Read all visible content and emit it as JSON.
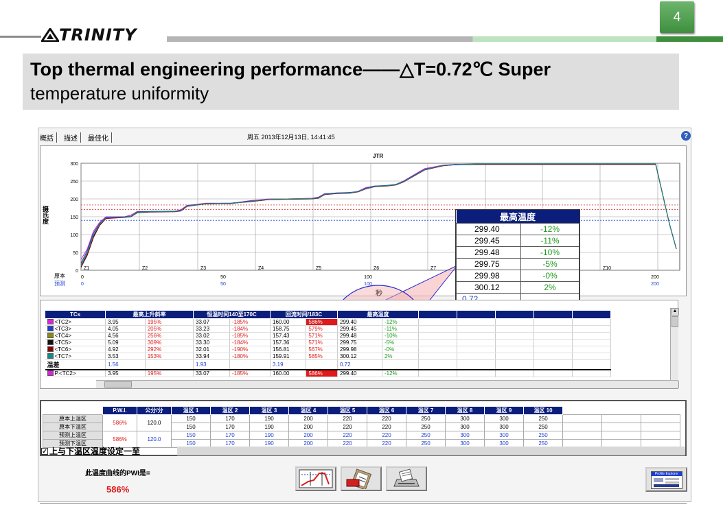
{
  "slide": {
    "page_number": "4",
    "logo": "TRINITY",
    "title_line1": "Top thermal engineering performance——△T=0.72℃ Super",
    "title_line2": "temperature uniformity"
  },
  "app": {
    "tabs": [
      "概括",
      "描述",
      "最佳化"
    ],
    "datetime": "周五 2013年12月13日, 14:41:45",
    "help_icon": "?"
  },
  "chart_data": {
    "type": "line",
    "title": "JTR",
    "ylabel": "摄氏度",
    "xlabel": "秒",
    "ylim": [
      0,
      300
    ],
    "xlim": [
      0,
      200
    ],
    "y_ticks": [
      "300",
      "250",
      "200",
      "150",
      "100",
      "50",
      "0"
    ],
    "x_ticks_top": [
      "0",
      "50",
      "100",
      "150",
      "200"
    ],
    "x_ticks_bottom": [
      "0",
      "50",
      "100",
      "150",
      "200"
    ],
    "row_labels": [
      "原本",
      "预测"
    ],
    "zone_labels": [
      "Z1",
      "Z2",
      "Z3",
      "Z4",
      "Z5",
      "Z6",
      "Z7",
      "Z8",
      "Z9",
      "Z10"
    ],
    "reference_lines": [
      183,
      170,
      140
    ],
    "series": [
      {
        "color": "#e020e0",
        "x": [
          0,
          5,
          10,
          15,
          20,
          35,
          40,
          45,
          55,
          75,
          80,
          85,
          100,
          120,
          125,
          135,
          145,
          150,
          165,
          185,
          190,
          195,
          205,
          215,
          222,
          228,
          235,
          240,
          245,
          252,
          258,
          275,
          290,
          300,
          320,
          330,
          340,
          345,
          350,
          355,
          360,
          365,
          372,
          380,
          390,
          400,
          410,
          420,
          430,
          440,
          450,
          460
        ],
        "y": [
          30,
          60,
          110,
          135,
          150,
          150,
          155,
          165,
          165,
          165,
          170,
          182,
          188,
          188,
          190,
          195,
          198,
          200,
          200,
          202,
          205,
          215,
          217,
          217,
          222,
          232,
          236,
          236,
          238,
          240,
          250,
          285,
          295,
          297,
          297,
          297,
          297,
          297,
          297,
          297,
          297,
          297,
          297,
          297,
          297,
          297,
          297,
          297,
          297,
          297,
          297,
          297
        ]
      },
      {
        "color": "#1e3fd0",
        "x": [
          0,
          5,
          10,
          15,
          20,
          35,
          40,
          45,
          55,
          75,
          80,
          85,
          100,
          120,
          125,
          135,
          145,
          150,
          165,
          185,
          190,
          195,
          205,
          215,
          222,
          228,
          235,
          240,
          245,
          252,
          258,
          275,
          290,
          300,
          320,
          330,
          340,
          345,
          350,
          355,
          360,
          365,
          372,
          380,
          390,
          400,
          410,
          420,
          430,
          440,
          450,
          460
        ],
        "y": [
          20,
          55,
          105,
          132,
          148,
          150,
          152,
          164,
          165,
          166,
          168,
          181,
          187,
          188,
          190,
          194,
          197,
          199,
          200,
          201,
          204,
          214,
          217,
          218,
          221,
          230,
          236,
          237,
          238,
          241,
          249,
          283,
          294,
          297,
          298,
          298,
          298,
          298,
          298,
          298,
          298,
          298,
          298,
          298,
          298,
          298,
          298,
          298,
          298,
          298,
          298,
          298
        ]
      },
      {
        "color": "#7a7a00",
        "x": [
          0,
          5,
          10,
          15,
          20,
          35,
          40,
          45,
          55,
          75,
          80,
          85,
          100,
          120,
          125,
          135,
          145,
          150,
          165,
          185,
          190,
          195,
          205,
          215,
          222,
          228,
          235,
          240,
          245,
          252,
          258,
          275,
          290,
          300,
          320,
          330,
          340,
          345,
          350,
          355,
          360,
          365,
          372,
          380,
          390,
          400,
          410,
          420,
          430,
          440,
          450,
          460
        ],
        "y": [
          15,
          50,
          100,
          130,
          147,
          149,
          151,
          163,
          164,
          165,
          167,
          180,
          187,
          187,
          189,
          193,
          197,
          199,
          200,
          201,
          203,
          213,
          216,
          217,
          221,
          229,
          235,
          236,
          237,
          240,
          248,
          282,
          294,
          296,
          297,
          297,
          297,
          297,
          297,
          297,
          297,
          297,
          297,
          297,
          297,
          297,
          297,
          297,
          297,
          297,
          297,
          297
        ]
      },
      {
        "color": "#111111",
        "x": [
          0,
          5,
          10,
          15,
          20,
          35,
          40,
          45,
          55,
          75,
          80,
          85,
          100,
          120,
          125,
          135,
          145,
          150,
          165,
          185,
          190,
          195,
          205,
          215,
          222,
          228,
          235,
          240,
          245,
          252,
          258,
          275,
          290,
          300,
          320,
          330,
          340,
          345,
          350,
          355,
          360,
          365,
          372,
          380,
          390,
          400,
          410,
          420,
          430,
          440,
          450,
          460
        ],
        "y": [
          10,
          45,
          95,
          128,
          146,
          149,
          150,
          162,
          164,
          165,
          167,
          180,
          186,
          187,
          189,
          193,
          196,
          198,
          199,
          200,
          203,
          212,
          216,
          217,
          220,
          229,
          235,
          236,
          237,
          240,
          248,
          282,
          293,
          296,
          297,
          297,
          297,
          297,
          297,
          297,
          297,
          297,
          297,
          297,
          297,
          297,
          297,
          297,
          297,
          297,
          297,
          297
        ]
      },
      {
        "color": "#8b0000",
        "x": [
          0,
          5,
          10,
          15,
          20,
          35,
          40,
          45,
          55,
          75,
          80,
          85,
          100,
          120,
          125,
          135,
          145,
          150,
          165,
          185,
          190,
          195,
          205,
          215,
          222,
          228,
          235,
          240,
          245,
          252,
          258,
          275,
          290,
          300,
          320,
          330,
          340,
          345,
          350,
          355,
          360,
          365,
          372,
          380,
          390,
          400,
          410,
          420,
          430,
          440,
          450,
          460
        ],
        "y": [
          8,
          42,
          92,
          126,
          145,
          148,
          150,
          161,
          163,
          164,
          166,
          179,
          186,
          187,
          189,
          192,
          196,
          198,
          199,
          200,
          202,
          212,
          215,
          216,
          220,
          228,
          234,
          235,
          236,
          239,
          247,
          281,
          293,
          296,
          297,
          297,
          297,
          297,
          297,
          297,
          297,
          297,
          297,
          297,
          297,
          297,
          297,
          297,
          297,
          297,
          297,
          297
        ]
      },
      {
        "color": "#138a8a",
        "x": [
          0,
          5,
          10,
          15,
          20,
          35,
          40,
          45,
          55,
          75,
          80,
          85,
          100,
          120,
          125,
          135,
          145,
          150,
          165,
          185,
          190,
          195,
          205,
          215,
          222,
          228,
          235,
          240,
          245,
          252,
          258,
          275,
          290,
          300,
          320,
          330,
          340,
          345,
          350,
          355,
          360,
          365,
          372,
          380,
          390,
          400,
          410,
          420,
          430,
          440,
          450,
          460
        ],
        "y": [
          12,
          48,
          98,
          129,
          147,
          149,
          151,
          162,
          164,
          165,
          167,
          180,
          186,
          187,
          189,
          193,
          197,
          199,
          200,
          201,
          203,
          213,
          216,
          217,
          221,
          229,
          235,
          236,
          237,
          240,
          248,
          282,
          294,
          296,
          298,
          298,
          298,
          298,
          298,
          298,
          298,
          298,
          298,
          298,
          298,
          298,
          298,
          298,
          298,
          298,
          298,
          298
        ]
      }
    ]
  },
  "popup": {
    "header": "最高温度",
    "rows": [
      {
        "value": "299.40",
        "pct": "-12%"
      },
      {
        "value": "299.45",
        "pct": "-11%"
      },
      {
        "value": "299.48",
        "pct": "-10%"
      },
      {
        "value": "299.75",
        "pct": "-5%"
      },
      {
        "value": "299.98",
        "pct": "-0%"
      },
      {
        "value": "300.12",
        "pct": "2%"
      }
    ],
    "delta": "0.72"
  },
  "tc_table": {
    "headers": [
      "TCs",
      "最高上升斜率",
      "恒温时间140至170C",
      "回流时间/183C",
      "最高温度"
    ],
    "rows": [
      {
        "name": "<TC2>",
        "color": "#e020e0",
        "slope": "3.95",
        "slope_pct": "195%",
        "soak": "33.07",
        "soak_pct": "-185%",
        "reflow": "160.00",
        "reflow_pct": "586%",
        "reflow_hl": true,
        "peak": "299.40",
        "peak_pct": "-12%"
      },
      {
        "name": "<TC3>",
        "color": "#1e3fd0",
        "slope": "4.05",
        "slope_pct": "205%",
        "soak": "33.23",
        "soak_pct": "-184%",
        "reflow": "158.75",
        "reflow_pct": "579%",
        "reflow_hl": false,
        "peak": "299.45",
        "peak_pct": "-11%"
      },
      {
        "name": "<TC4>",
        "color": "#8a8a10",
        "slope": "4.56",
        "slope_pct": "256%",
        "soak": "33.02",
        "soak_pct": "-185%",
        "reflow": "157.43",
        "reflow_pct": "571%",
        "reflow_hl": false,
        "peak": "299.48",
        "peak_pct": "-10%"
      },
      {
        "name": "<TC5>",
        "color": "#111111",
        "slope": "5.09",
        "slope_pct": "309%",
        "soak": "33.30",
        "soak_pct": "-184%",
        "reflow": "157.36",
        "reflow_pct": "571%",
        "reflow_hl": false,
        "peak": "299.75",
        "peak_pct": "-5%"
      },
      {
        "name": "<TC6>",
        "color": "#8b0000",
        "slope": "4.92",
        "slope_pct": "292%",
        "soak": "32.01",
        "soak_pct": "-190%",
        "reflow": "156.81",
        "reflow_pct": "567%",
        "reflow_hl": false,
        "peak": "299.98",
        "peak_pct": "-0%"
      },
      {
        "name": "<TC7>",
        "color": "#138a8a",
        "slope": "3.53",
        "slope_pct": "153%",
        "soak": "33.94",
        "soak_pct": "-180%",
        "reflow": "159.91",
        "reflow_pct": "585%",
        "reflow_hl": false,
        "peak": "300.12",
        "peak_pct": "2%"
      }
    ],
    "delta_row": {
      "name": "温差",
      "slope": "1.56",
      "soak": "1.93",
      "reflow": "3.19",
      "peak": "0.72"
    },
    "pred_row": {
      "name": "P.<TC2>",
      "color": "#e020e0",
      "slope": "3.95",
      "slope_pct": "195%",
      "soak": "33.07",
      "soak_pct": "-185%",
      "reflow": "160.00",
      "reflow_pct": "586%",
      "peak": "299.40",
      "peak_pct": "-12%"
    }
  },
  "zone_table": {
    "headers": [
      "P.W.I.",
      "公分/分",
      "温区 1",
      "温区 2",
      "温区 3",
      "温区 4",
      "温区 5",
      "温区 6",
      "温区 7",
      "温区 8",
      "温区 9",
      "温区 10"
    ],
    "labels": [
      "原本上温区",
      "原本下温区",
      "预测上温区",
      "预测下温区"
    ],
    "pwi_original": "586%",
    "speed_original": "120.0",
    "pwi_predicted": "586%",
    "speed_predicted": "120.0",
    "rows": [
      [
        "150",
        "170",
        "190",
        "200",
        "220",
        "220",
        "250",
        "300",
        "300",
        "250"
      ],
      [
        "150",
        "170",
        "190",
        "200",
        "220",
        "220",
        "250",
        "300",
        "300",
        "250"
      ],
      [
        "150",
        "170",
        "190",
        "200",
        "220",
        "220",
        "250",
        "300",
        "300",
        "250"
      ],
      [
        "150",
        "170",
        "190",
        "200",
        "220",
        "220",
        "250",
        "300",
        "300",
        "250"
      ]
    ],
    "sync_label": "上与下温区温度设定一至",
    "sync_check": "✓"
  },
  "footer": {
    "pwi_label": "此温度曲线的PWI是=",
    "pwi_value": "586%",
    "explorer_label": "Profile Explorer"
  }
}
